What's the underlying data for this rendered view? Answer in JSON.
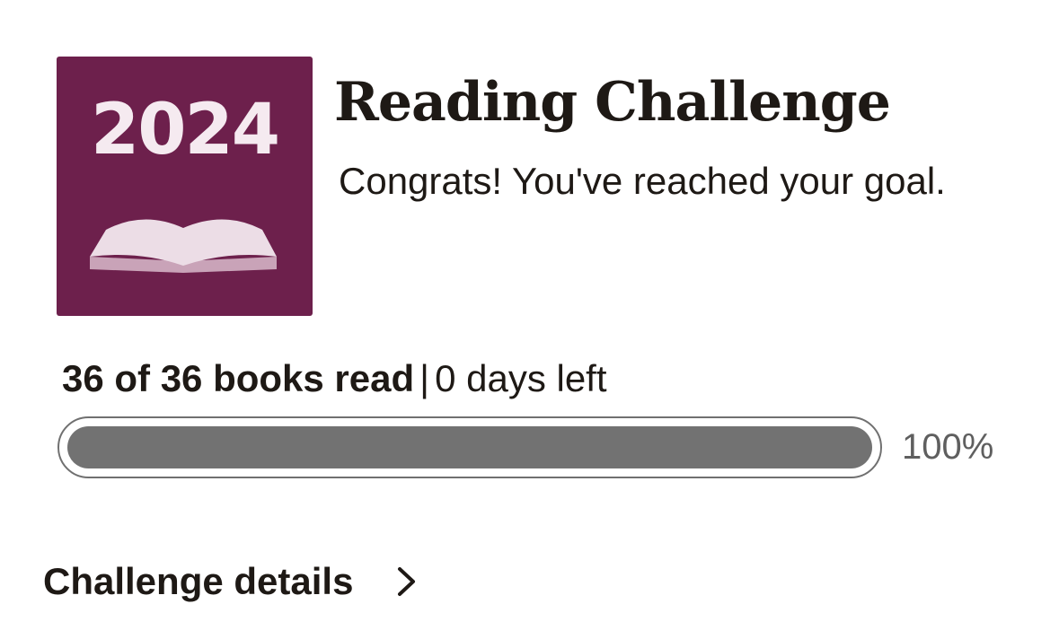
{
  "badge": {
    "year": "2024",
    "icon": "open-book-icon",
    "background_color": "#6d204c"
  },
  "header": {
    "title": "Reading Challenge",
    "subtitle": "Congrats! You've reached your goal."
  },
  "progress": {
    "books_read_text": "36 of 36 books read",
    "separator": "|",
    "days_left_text": "0 days left",
    "percent_label": "100%",
    "fraction": 1.0
  },
  "details": {
    "label": "Challenge details",
    "icon": "chevron-right-icon"
  }
}
